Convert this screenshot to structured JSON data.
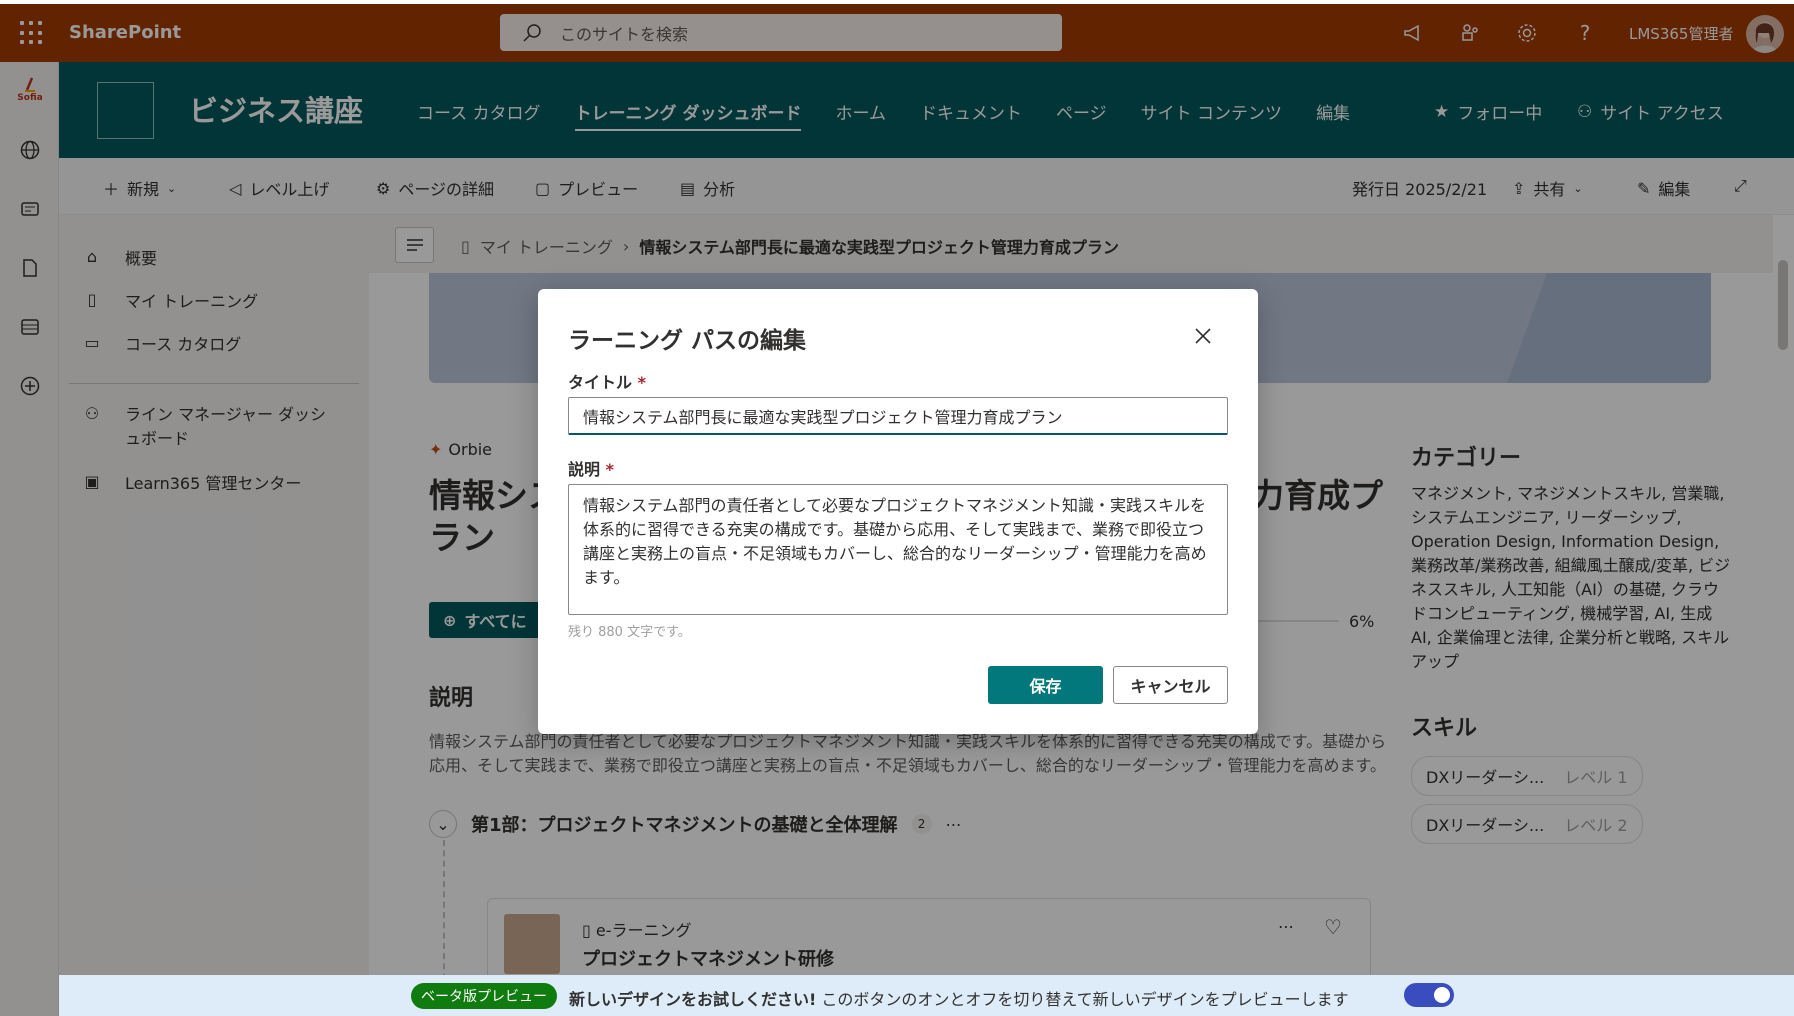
{
  "suite": {
    "brand": "SharePoint",
    "search_placeholder": "このサイトを検索",
    "user": "LMS365管理者"
  },
  "site": {
    "title": "ビジネス講座",
    "nav": [
      "コース カタログ",
      "トレーニング ダッシュボード",
      "ホーム",
      "ドキュメント",
      "ページ",
      "サイト コンテンツ",
      "編集"
    ],
    "follow": "フォロー中",
    "access": "サイト アクセス"
  },
  "appbar": {
    "logo_text": "Sofia"
  },
  "commandbar": {
    "new": "新規",
    "promote": "レベル上げ",
    "page_details": "ページの詳細",
    "preview": "プレビュー",
    "analytics": "分析",
    "published": "発行日 2025/2/21",
    "share": "共有",
    "edit": "編集"
  },
  "leftnav": {
    "items": [
      "概要",
      "マイ トレーニング",
      "コース カタログ"
    ],
    "items2": [
      "ライン マネージャー ダッシュボード",
      "Learn365 管理センター"
    ]
  },
  "breadcrumb": {
    "root": "マイ トレーニング",
    "current": "情報システム部門長に最適な実践型プロジェクト管理力育成プラン"
  },
  "page": {
    "author": "Orbie",
    "title_part1": "情報シス",
    "title_part1b": "ラン",
    "title_part2": "力育成プ",
    "all_button": "すべてに",
    "progress": "6%",
    "desc_heading": "説明",
    "description": "情報システム部門の責任者として必要なプロジェクトマネジメント知識・実践スキルを体系的に習得できる充実の構成です。基礎から応用、そして実践まで、業務で即役立つ講座と実務上の盲点・不足領域もカバーし、総合的なリーダーシップ・管理能力を高めます。",
    "section_title": "第1部：プロジェクトマネジメントの基礎と全体理解",
    "section_count": "2",
    "course_type": "e-ラーニング",
    "course_title": "プロジェクトマネジメント研修"
  },
  "sidebar": {
    "category_heading": "カテゴリー",
    "categories": "マネジメント, マネジメントスキル, 営業職, システムエンジニア, リーダーシップ, Operation Design, Information Design, 業務改革/業務改善, 組織風土醸成/変革, ビジネススキル, 人工知能（AI）の基礎, クラウドコンピューティング, 機械学習, AI, 生成AI, 企業倫理と法律, 企業分析と戦略, スキルアップ",
    "skills_heading": "スキル",
    "skills": [
      {
        "name": "DXリーダーシ...",
        "level": "レベル 1"
      },
      {
        "name": "DXリーダーシ...",
        "level": "レベル 2"
      }
    ]
  },
  "beta": {
    "badge": "ベータ版プレビュー",
    "bold": "新しいデザインをお試しください!",
    "text": " このボタンのオンとオフを切り替えて新しいデザインをプレビューします"
  },
  "dialog": {
    "title": "ラーニング パスの編集",
    "title_label": "タイトル",
    "title_value": "情報システム部門長に最適な実践型プロジェクト管理力育成プラン",
    "desc_label": "説明",
    "desc_value": "情報システム部門の責任者として必要なプロジェクトマネジメント知識・実践スキルを体系的に習得できる充実の構成です。基礎から応用、そして実践まで、業務で即役立つ講座と実務上の盲点・不足領域もカバーし、総合的なリーダーシップ・管理能力を高めます。",
    "remaining": "残り 880 文字です。",
    "save": "保存",
    "cancel": "キャンセル",
    "required": "*"
  }
}
